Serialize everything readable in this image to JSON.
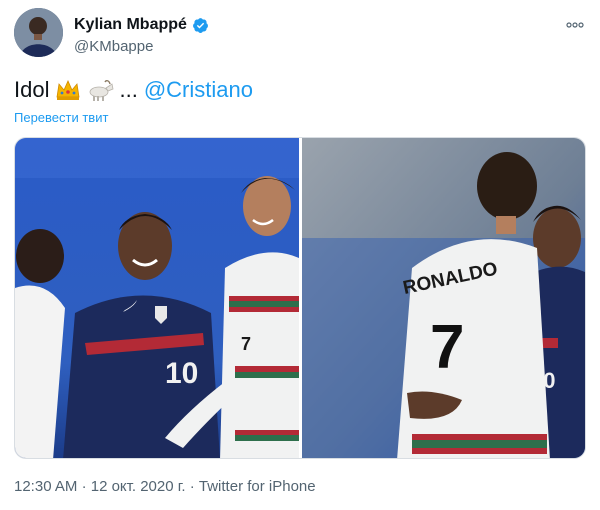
{
  "author": {
    "name": "Kylian Mbappé",
    "handle": "@KMbappe",
    "verified": true,
    "avatar_icon": "avatar"
  },
  "more_icon": "more-horizontal-icon",
  "tweet": {
    "text_before": "Idol",
    "emojis": [
      "crown-emoji",
      "goat-emoji"
    ],
    "ellipsis": "...",
    "mention": "@Cristiano",
    "translate_label": "Перевести твит"
  },
  "media": {
    "photo1_alt": "Photo 1",
    "photo2_alt": "Photo 2",
    "jersey_name": "RONALDO",
    "jersey_number_back": "7",
    "jersey_number_front": "10",
    "jersey_number_side": "10",
    "jersey_number_portugal": "7"
  },
  "meta": {
    "time": "12:30 AM",
    "separator1": "·",
    "date": "12 окт. 2020 г.",
    "separator2": "·",
    "source": "Twitter for iPhone"
  },
  "colors": {
    "accent": "#1d9bf0",
    "text": "#0f1419",
    "muted": "#536471",
    "france_blue": "#1c2a5c",
    "portugal_green": "#2e6f4c",
    "portugal_red": "#b32a36",
    "stadium_blue": "#2f5fbf"
  }
}
